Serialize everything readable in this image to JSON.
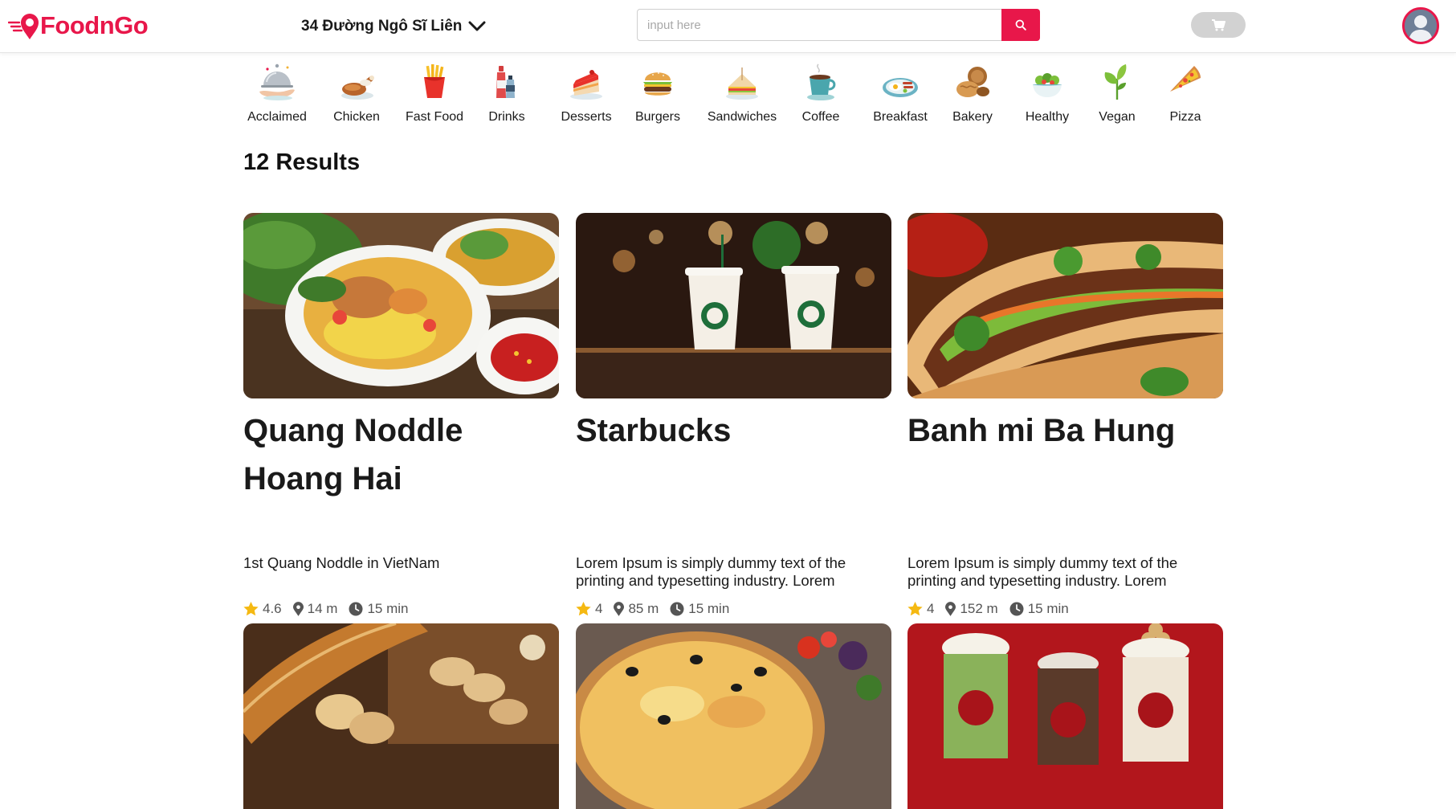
{
  "header": {
    "brand": "FoodnGo",
    "address": "34 Đường Ngô Sĩ Liên",
    "search_placeholder": "input here",
    "accent": "#e8174a"
  },
  "categories": [
    {
      "label": "Acclaimed",
      "icon": "serving-cloche-icon"
    },
    {
      "label": "Chicken",
      "icon": "roast-chicken-icon"
    },
    {
      "label": "Fast Food",
      "icon": "french-fries-icon"
    },
    {
      "label": "Drinks",
      "icon": "drink-bottles-icon"
    },
    {
      "label": "Desserts",
      "icon": "cake-slice-icon"
    },
    {
      "label": "Burgers",
      "icon": "burger-icon"
    },
    {
      "label": "Sandwiches",
      "icon": "sandwich-icon"
    },
    {
      "label": "Coffee",
      "icon": "coffee-cup-icon"
    },
    {
      "label": "Breakfast",
      "icon": "breakfast-plate-icon"
    },
    {
      "label": "Bakery",
      "icon": "bread-icon"
    },
    {
      "label": "Healthy",
      "icon": "salad-bowl-icon"
    },
    {
      "label": "Vegan",
      "icon": "sprout-icon"
    },
    {
      "label": "Pizza",
      "icon": "pizza-slice-icon"
    }
  ],
  "results": {
    "title": "12 Results",
    "items": [
      {
        "name": "Quang Noddle Hoang Hai",
        "description": "1st Quang Noddle in VietNam",
        "rating": "4.6",
        "distance": "14 m",
        "time": "15 min",
        "image": "quang-noodle-photo"
      },
      {
        "name": "Starbucks",
        "description": "Lorem Ipsum is simply dummy text of the printing and typesetting industry. Lorem",
        "rating": "4",
        "distance": "85 m",
        "time": "15 min",
        "image": "starbucks-cups-photo"
      },
      {
        "name": "Banh mi Ba Hung",
        "description": "Lorem Ipsum is simply dummy text of the printing and typesetting industry. Lorem",
        "rating": "4",
        "distance": "152 m",
        "time": "15 min",
        "image": "banh-mi-photo"
      },
      {
        "image": "baguette-bread-photo"
      },
      {
        "image": "pizza-photo"
      },
      {
        "image": "highlands-coffee-drinks-photo"
      }
    ]
  }
}
